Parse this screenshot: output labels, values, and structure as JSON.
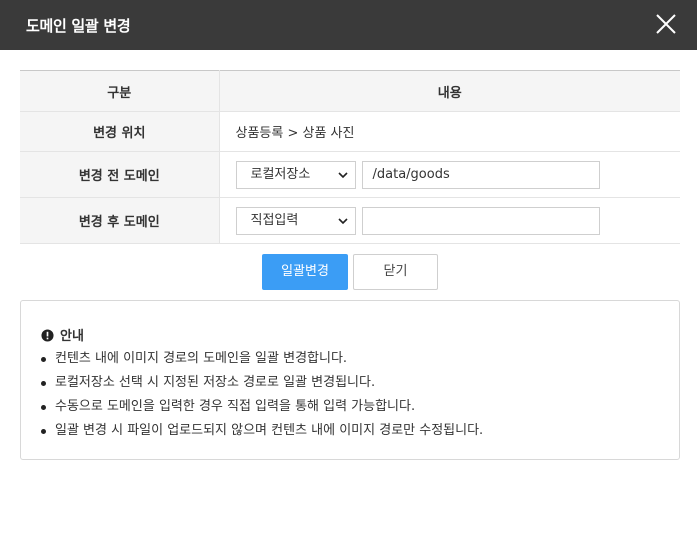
{
  "dialog": {
    "title": "도메인 일괄 변경",
    "close_icon": "close-icon"
  },
  "table": {
    "header": {
      "col1": "구분",
      "col2": "내용"
    },
    "rows": [
      {
        "label": "변경 위치",
        "value": "상품등록 > 상품 사진"
      },
      {
        "label": "변경 전 도메인",
        "select": "로컬저장소",
        "input": "/data/goods"
      },
      {
        "label": "변경 후 도메인",
        "select": "직접입력",
        "input": ""
      }
    ]
  },
  "buttons": {
    "apply": "일괄변경",
    "close": "닫기"
  },
  "colors": {
    "titlebar": "#3a3a3a",
    "primary": "#3b9df5"
  },
  "notice": {
    "icon": "exclamation-circle-icon",
    "title": "안내",
    "items": [
      "컨텐츠 내에 이미지 경로의 도메인을 일괄 변경합니다.",
      "로컬저장소 선택 시 지정된 저장소 경로로 일괄 변경됩니다.",
      "수동으로 도메인을 입력한 경우 직접 입력을 통해 입력 가능합니다.",
      "일괄 변경 시 파일이 업로드되지 않으며 컨텐츠 내에 이미지 경로만 수정됩니다."
    ]
  }
}
